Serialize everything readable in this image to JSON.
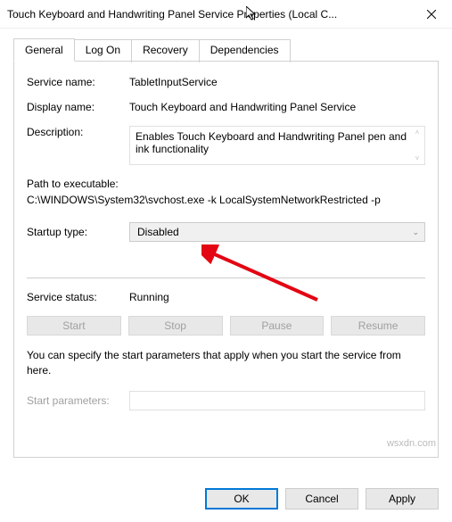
{
  "window": {
    "title": "Touch Keyboard and Handwriting Panel Service Properties (Local C..."
  },
  "tabs": {
    "general": "General",
    "logon": "Log On",
    "recovery": "Recovery",
    "dependencies": "Dependencies"
  },
  "labels": {
    "service_name": "Service name:",
    "display_name": "Display name:",
    "description": "Description:",
    "path": "Path to executable:",
    "startup_type": "Startup type:",
    "service_status": "Service status:",
    "start_parameters": "Start parameters:"
  },
  "values": {
    "service_name": "TabletInputService",
    "display_name": "Touch Keyboard and Handwriting Panel Service",
    "description": "Enables Touch Keyboard and Handwriting Panel pen and ink functionality",
    "path": "C:\\WINDOWS\\System32\\svchost.exe -k LocalSystemNetworkRestricted -p",
    "startup_type": "Disabled",
    "service_status": "Running"
  },
  "buttons": {
    "start": "Start",
    "stop": "Stop",
    "pause": "Pause",
    "resume": "Resume",
    "ok": "OK",
    "cancel": "Cancel",
    "apply": "Apply"
  },
  "note": "You can specify the start parameters that apply when you start the service from here.",
  "watermark": "wsxdn.com"
}
